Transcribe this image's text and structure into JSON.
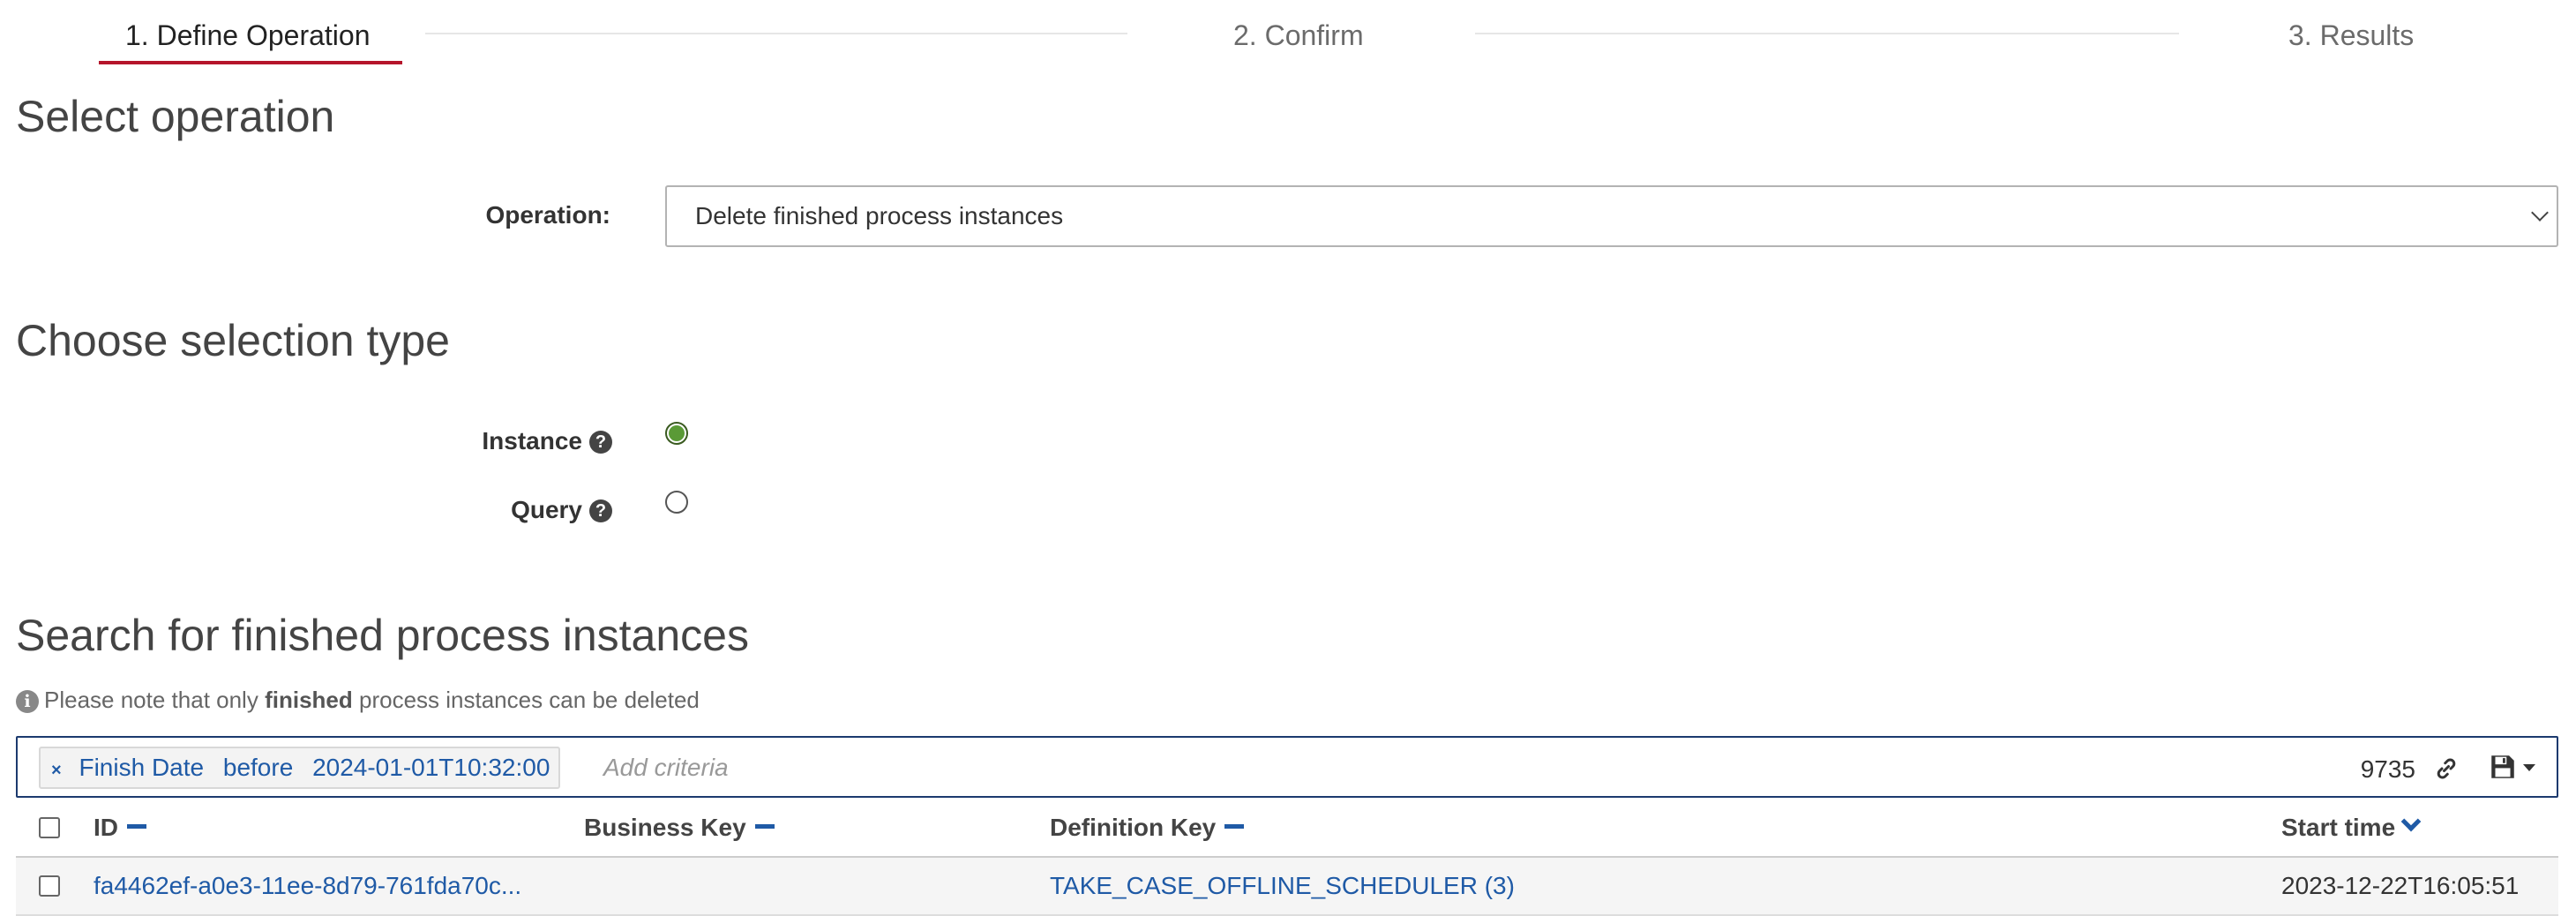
{
  "wizard": {
    "steps": [
      {
        "label": "1. Define Operation",
        "active": true
      },
      {
        "label": "2. Confirm",
        "active": false
      },
      {
        "label": "3. Results",
        "active": false
      }
    ]
  },
  "operation_section": {
    "title": "Select operation",
    "label": "Operation:",
    "selected": "Delete finished process instances"
  },
  "selection_section": {
    "title": "Choose selection type",
    "options": [
      {
        "label": "Instance",
        "checked": true
      },
      {
        "label": "Query",
        "checked": false
      }
    ]
  },
  "search_section": {
    "title": "Search for finished process instances",
    "note_prefix": "Please note that only",
    "note_bold": "finished",
    "note_suffix": "process instances can be deleted",
    "criterion": {
      "field": "Finish Date",
      "operator": "before",
      "value": "2024-01-01T10:32:00"
    },
    "add_criteria_placeholder": "Add criteria",
    "result_count": "9735"
  },
  "table": {
    "columns": [
      "ID",
      "Business Key",
      "Definition Key",
      "Start time"
    ],
    "rows": [
      {
        "id": "fa4462ef-a0e3-11ee-8d79-761fda70c...",
        "business_key": "",
        "definition_key": "TAKE_CASE_OFFLINE_SCHEDULER (3)",
        "start_time": "2023-12-22T16:05:51"
      }
    ]
  },
  "colors": {
    "accent": "#b5152b",
    "link": "#1f5aa6",
    "radio_checked": "#5a9a36"
  }
}
